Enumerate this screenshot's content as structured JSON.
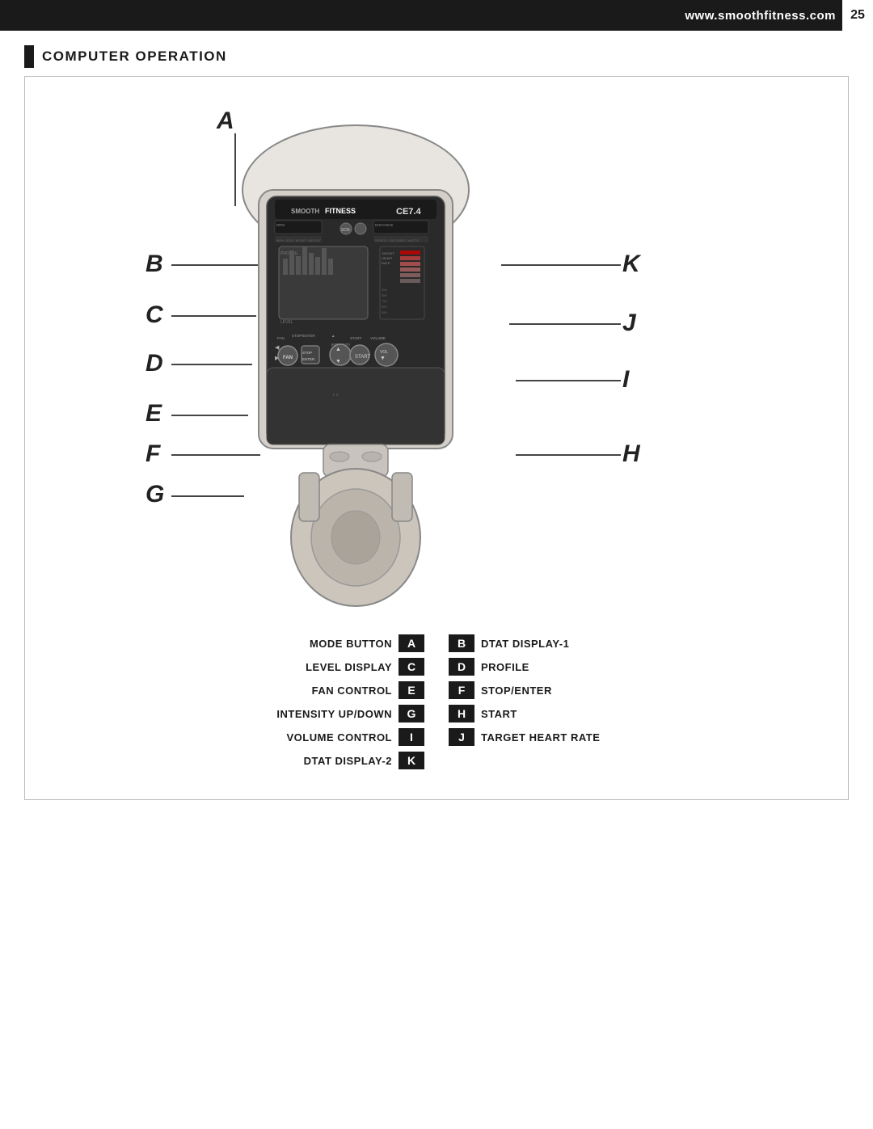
{
  "header": {
    "url": "www.smoothfitness.com",
    "page_number": "25"
  },
  "section": {
    "title": "COMPUTER OPERATION"
  },
  "labels": {
    "A": "A",
    "B": "B",
    "C": "C",
    "D": "D",
    "E": "E",
    "F": "F",
    "G": "G",
    "H": "H",
    "I": "I",
    "J": "J",
    "K": "K"
  },
  "legend": {
    "left_col": [
      {
        "label": "MODE BUTTON",
        "badge": "A"
      },
      {
        "label": "LEVEL DISPLAY",
        "badge": "C"
      },
      {
        "label": "FAN CONTROL",
        "badge": "E"
      },
      {
        "label": "INTENSITY UP/DOWN",
        "badge": "G"
      },
      {
        "label": "VOLUME CONTROL",
        "badge": "I"
      },
      {
        "label": "DTAT DISPLAY-2",
        "badge": "K"
      }
    ],
    "right_col": [
      {
        "badge": "B",
        "label": "DTAT DISPLAY-1"
      },
      {
        "badge": "D",
        "label": "PROFILE"
      },
      {
        "badge": "F",
        "label": "STOP/ENTER"
      },
      {
        "badge": "H",
        "label": "START"
      },
      {
        "badge": "J",
        "label": "TARGET HEART RATE"
      },
      {
        "badge": "",
        "label": ""
      }
    ]
  }
}
